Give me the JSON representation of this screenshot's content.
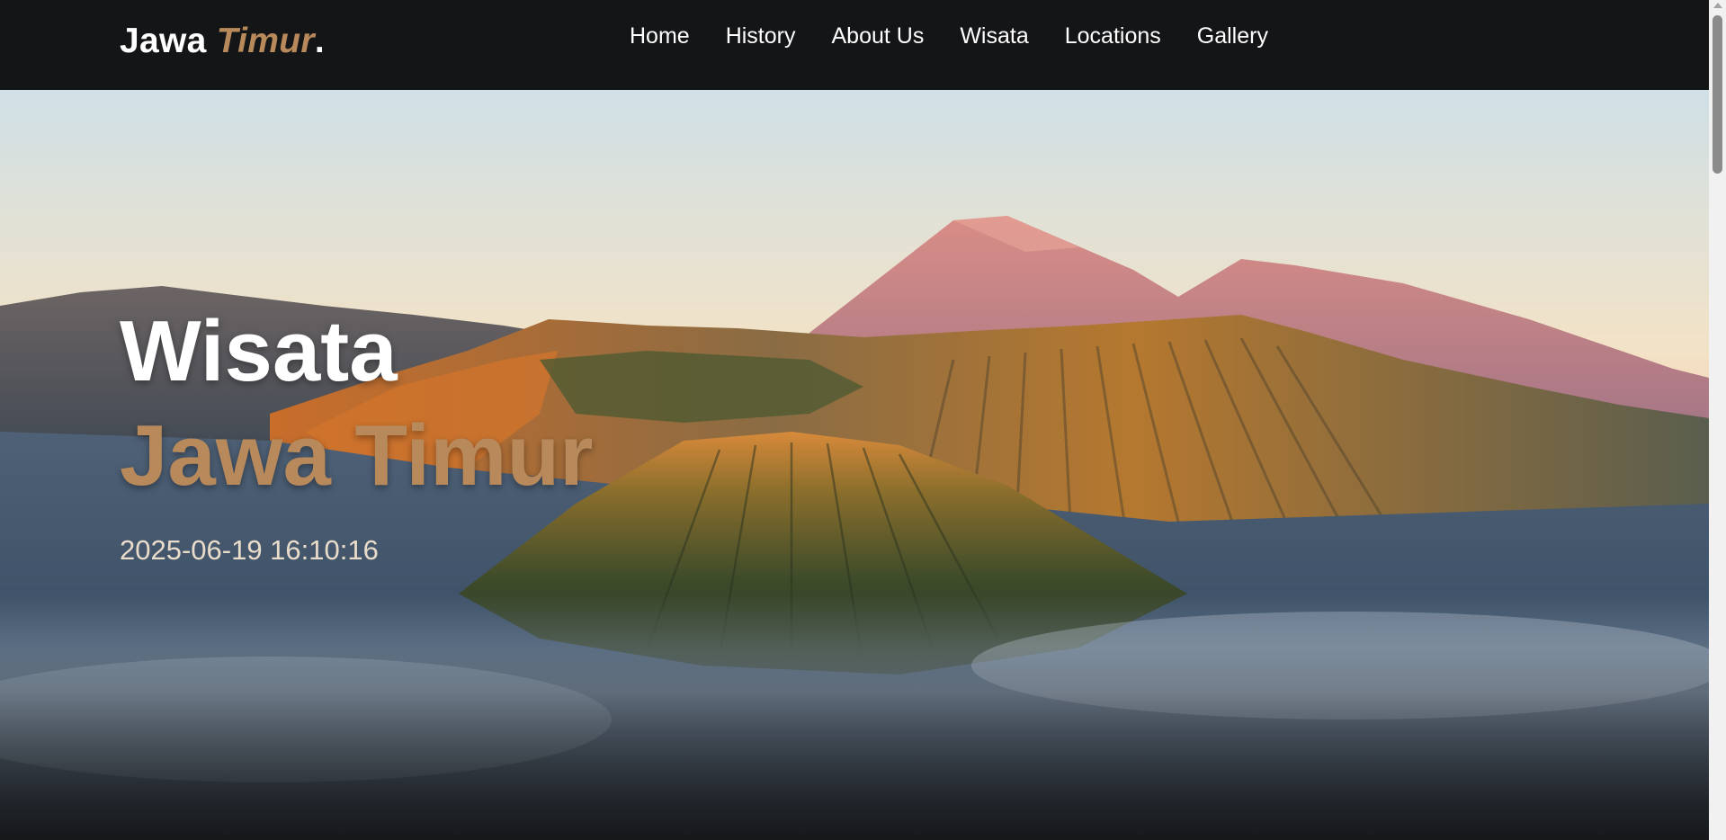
{
  "brand": {
    "main": "Jawa",
    "accent": "Timur",
    "dot": "."
  },
  "nav": {
    "items": [
      {
        "label": "Home"
      },
      {
        "label": "History"
      },
      {
        "label": "About Us"
      },
      {
        "label": "Wisata"
      },
      {
        "label": "Locations"
      },
      {
        "label": "Gallery"
      }
    ]
  },
  "hero": {
    "title_line1": "Wisata",
    "title_line2": "Jawa Timur",
    "datetime": "2025-06-19 16:10:16"
  },
  "colors": {
    "navbar_bg": "#141517",
    "accent": "#b8895b",
    "text": "#ffffff"
  }
}
